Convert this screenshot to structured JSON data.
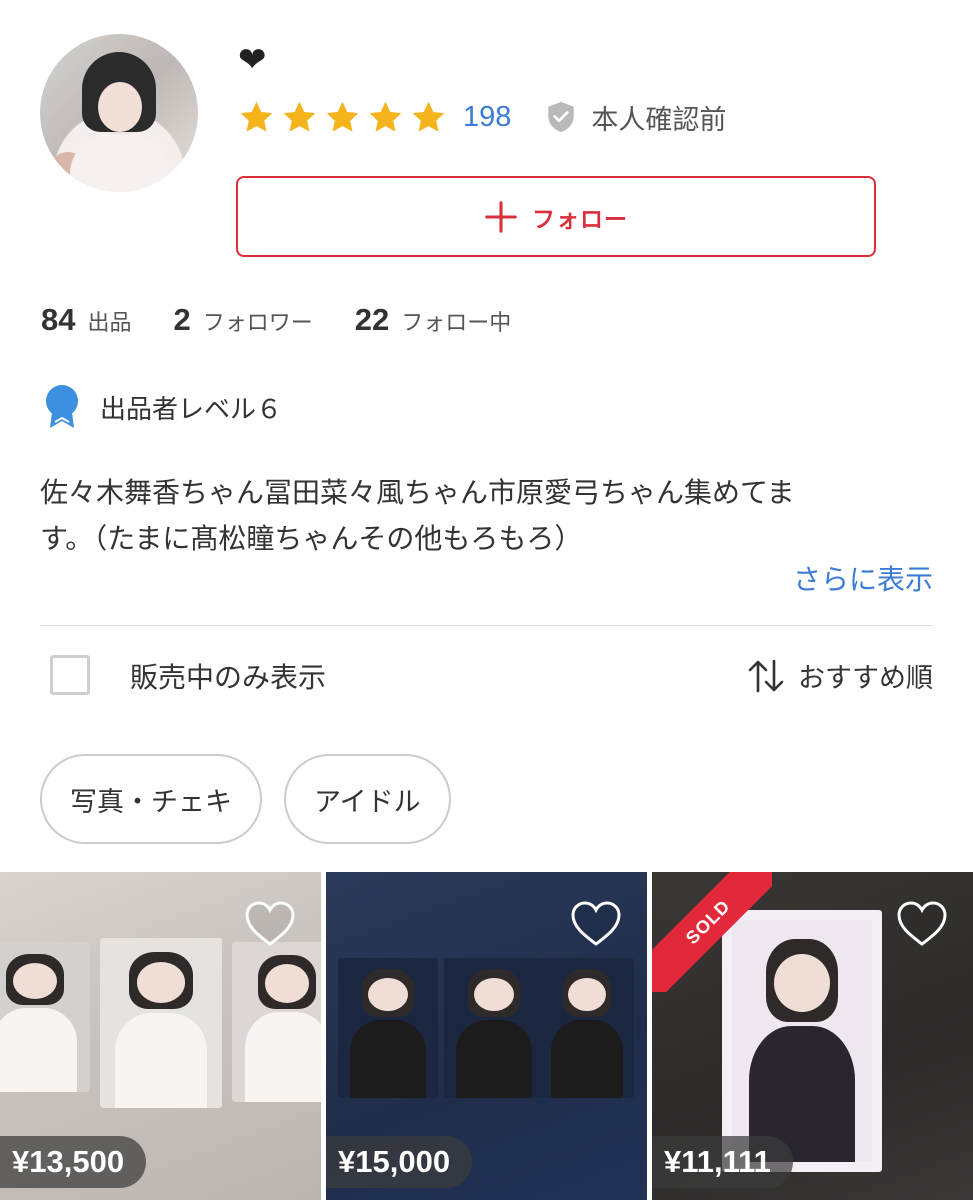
{
  "profile": {
    "name": "❤",
    "rating": 5,
    "review_count": "198",
    "verification": "本人確認前",
    "follow_label": "フォロー",
    "stats": [
      {
        "value": "84",
        "label": "出品"
      },
      {
        "value": "2",
        "label": "フォロワー"
      },
      {
        "value": "22",
        "label": "フォロー中"
      }
    ],
    "level_label": "出品者レベル６",
    "bio_line1": "佐々木舞香ちゃん冨田菜々風ちゃん市原愛弓ちゃん集めてま",
    "bio_line2": "す。（たまに髙松瞳ちゃんその他もろもろ）",
    "more_link": "さらに表示"
  },
  "filters": {
    "on_sale_only_label": "販売中のみ表示",
    "on_sale_only_checked": false,
    "sort_label": "おすすめ順"
  },
  "chips": [
    "写真・チェキ",
    "アイドル"
  ],
  "items": [
    {
      "price": "¥13,500",
      "sold": false
    },
    {
      "price": "¥15,000",
      "sold": false
    },
    {
      "price": "¥11,111",
      "sold": true,
      "sold_label": "SOLD"
    }
  ],
  "colors": {
    "accent_red": "#d9303c",
    "link_blue": "#3c7bd6",
    "star_yellow": "#f5b31c",
    "medal_blue": "#3d8fe0"
  }
}
